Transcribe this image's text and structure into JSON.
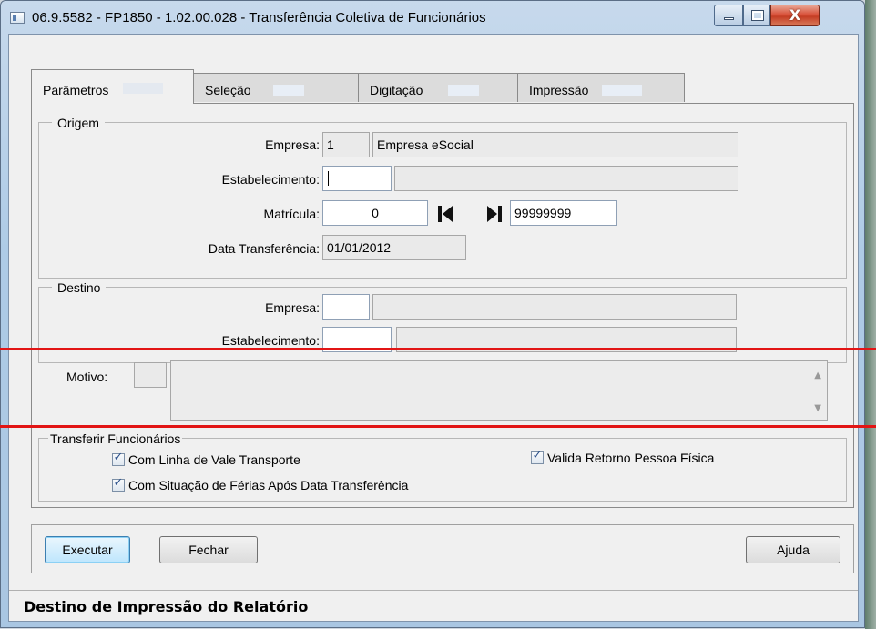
{
  "window": {
    "title": "06.9.5582 - FP1850 - 1.02.00.028 - Transferência Coletiva de Funcionários",
    "close_glyph": "X"
  },
  "tabs": [
    {
      "label": "Parâmetros",
      "active": true
    },
    {
      "label": "Seleção",
      "active": false
    },
    {
      "label": "Digitação",
      "active": false
    },
    {
      "label": "Impressão",
      "active": false
    }
  ],
  "origem": {
    "legend": "Origem",
    "empresa_label": "Empresa:",
    "empresa_code": "1",
    "empresa_name": "Empresa eSocial",
    "estabelecimento_label": "Estabelecimento:",
    "estabelecimento_code": "",
    "estabelecimento_name": "",
    "matricula_label": "Matrícula:",
    "matricula_ini": "0",
    "matricula_fim": "99999999",
    "data_label": "Data Transferência:",
    "data_value": "01/01/2012"
  },
  "destino": {
    "legend": "Destino",
    "empresa_label": "Empresa:",
    "empresa_code": "",
    "empresa_name": "",
    "estabelecimento_label": "Estabelecimento:",
    "estabelecimento_code": "",
    "estabelecimento_name": ""
  },
  "motivo": {
    "label": "Motivo:",
    "code": "",
    "text": ""
  },
  "transferir": {
    "legend": "Transferir Funcionários",
    "options": [
      {
        "label": "Com Linha de Vale Transporte",
        "checked": true
      },
      {
        "label": "Com Situação de Férias Após Data Transferência",
        "checked": true
      },
      {
        "label": "Valida Retorno Pessoa Física",
        "checked": true
      }
    ]
  },
  "buttons": {
    "executar": "Executar",
    "fechar": "Fechar",
    "ajuda": "Ajuda"
  },
  "status": {
    "text": "Destino de Impressão do Relatório"
  },
  "colors": {
    "annotation_line": "#e21515",
    "primary_button": "#bee6fd"
  }
}
